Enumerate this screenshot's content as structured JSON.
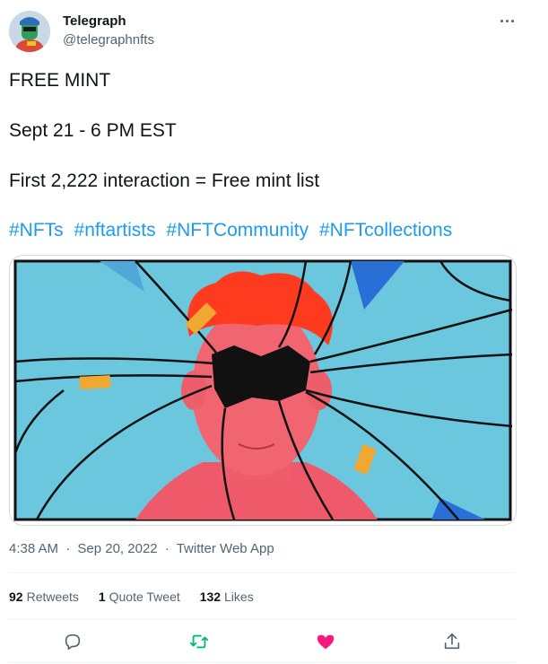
{
  "author": {
    "name": "Telegraph",
    "handle": "@telegraphnfts"
  },
  "tweet": {
    "lines": [
      "FREE MINT",
      "Sept 21 - 6 PM EST",
      "First 2,222 interaction = Free mint list"
    ],
    "hashtags": [
      "#NFTs",
      "#nftartists",
      "#NFTCommunity",
      "#NFTcollections"
    ]
  },
  "meta": {
    "time": "4:38 AM",
    "separator": "·",
    "date": "Sep 20, 2022",
    "source": "Twitter Web App"
  },
  "stats": {
    "retweets_count": "92",
    "retweets_label": "Retweets",
    "quotes_count": "1",
    "quotes_label": "Quote Tweet",
    "likes_count": "132",
    "likes_label": "Likes"
  },
  "actions": {
    "reply_icon": "reply-icon",
    "retweet_icon": "retweet-icon",
    "like_icon": "heart-icon",
    "share_icon": "share-icon"
  },
  "colors": {
    "link": "#1d9bf0",
    "retweet": "#00ba7c",
    "like": "#f91880",
    "muted": "#536471"
  }
}
